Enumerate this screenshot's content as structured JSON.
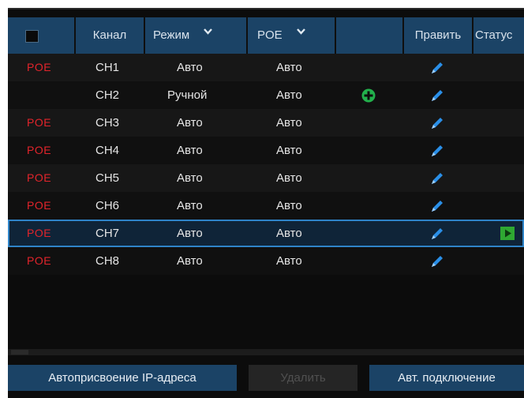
{
  "header": {
    "channel": "Канал",
    "mode": "Режим",
    "poe": "POE",
    "edit": "Править",
    "status": "Статус"
  },
  "rows": [
    {
      "poe": "POE",
      "channel": "CH1",
      "mode": "Авто",
      "poe_mode": "Авто"
    },
    {
      "poe": "",
      "channel": "CH2",
      "mode": "Ручной",
      "poe_mode": "Авто"
    },
    {
      "poe": "POE",
      "channel": "CH3",
      "mode": "Авто",
      "poe_mode": "Авто"
    },
    {
      "poe": "POE",
      "channel": "CH4",
      "mode": "Авто",
      "poe_mode": "Авто"
    },
    {
      "poe": "POE",
      "channel": "CH5",
      "mode": "Авто",
      "poe_mode": "Авто"
    },
    {
      "poe": "POE",
      "channel": "CH6",
      "mode": "Авто",
      "poe_mode": "Авто"
    },
    {
      "poe": "POE",
      "channel": "CH7",
      "mode": "Авто",
      "poe_mode": "Авто"
    },
    {
      "poe": "POE",
      "channel": "CH8",
      "mode": "Авто",
      "poe_mode": "Авто"
    }
  ],
  "footer": {
    "auto_ip": "Автоприсвоение IP-адреса",
    "delete": "Удалить",
    "auto_connect": "Авт. подключение"
  },
  "icons": {
    "edit": "pencil-icon",
    "add": "plus-circle-icon",
    "status": "play-icon",
    "dropdown": "chevron-down-icon"
  },
  "colors": {
    "header_bg": "#1b4366",
    "poe_red": "#e3242b",
    "pencil_blue": "#2a8fe8",
    "add_green": "#22b14c",
    "play_green": "#2fa832",
    "selection_border": "#2f84c8"
  }
}
